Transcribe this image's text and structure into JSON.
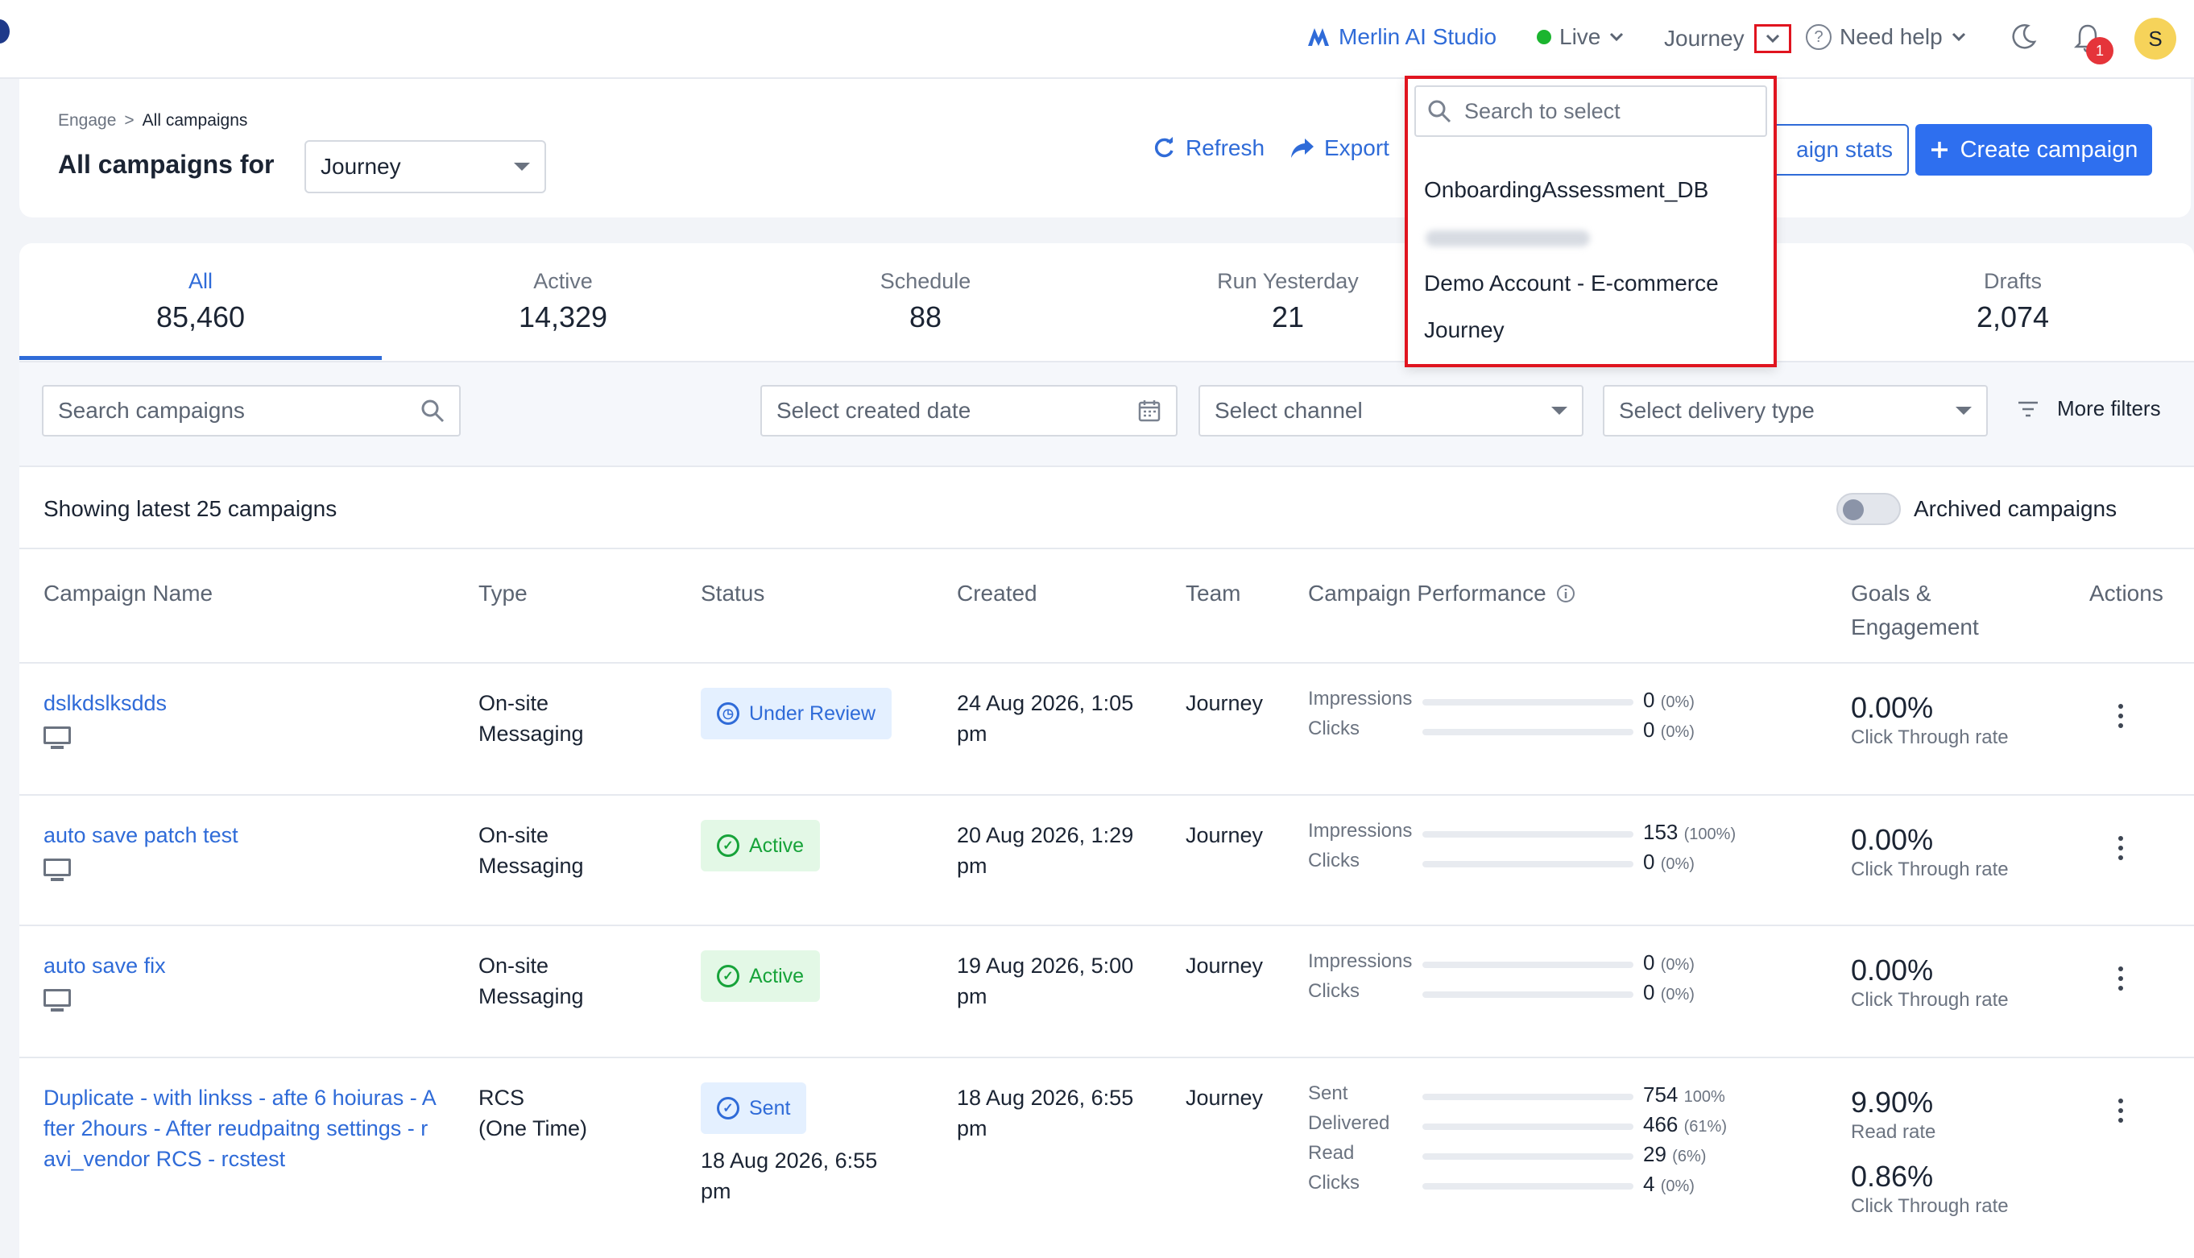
{
  "topbar": {
    "merlin_label": "Merlin AI Studio",
    "live_label": "Live",
    "journey_label": "Journey",
    "help_label": "Need help",
    "notification_count": "1",
    "avatar_initial": "S",
    "live_color": "#1bb52f",
    "accent_color": "#2f6bd8"
  },
  "header": {
    "breadcrumb": [
      "Engage",
      ">",
      "All campaigns"
    ],
    "title": "All campaigns for",
    "account_select_value": "Journey",
    "refresh_label": "Refresh",
    "export_label": "Export",
    "stats_label": "aign stats",
    "create_label": "Create campaign"
  },
  "dropdown": {
    "search_placeholder": "Search to select",
    "items": [
      "OnboardingAssessment_DB",
      "Demo Account - E-commerce",
      "Journey"
    ]
  },
  "tabs": [
    {
      "label": "All",
      "count": "85,460"
    },
    {
      "label": "Active",
      "count": "14,329"
    },
    {
      "label": "Schedule",
      "count": "88"
    },
    {
      "label": "Run Yesterday",
      "count": "21"
    },
    {
      "label": "",
      "count": ""
    },
    {
      "label": "Drafts",
      "count": "2,074"
    }
  ],
  "filters": {
    "search_placeholder": "Search campaigns",
    "date_placeholder": "Select created date",
    "channel_placeholder": "Select channel",
    "delivery_placeholder": "Select delivery type",
    "more_filters": "More filters"
  },
  "list": {
    "showing": "Showing latest 25 campaigns",
    "archived_label": "Archived campaigns"
  },
  "columns": {
    "name": "Campaign Name",
    "type": "Type",
    "status": "Status",
    "created": "Created",
    "team": "Team",
    "performance": "Campaign Performance",
    "goals": "Goals &",
    "goals2": "Engagement",
    "actions": "Actions"
  },
  "rows": [
    {
      "name": "dslkdslksdds",
      "type1": "On-site",
      "type2": "Messaging",
      "status": "Under Review",
      "created1": "24 Aug 2026, 1:05",
      "created2": "pm",
      "team": "Journey",
      "perf": [
        {
          "label": "Impressions",
          "fraction": 0,
          "value": "0",
          "pct": "(0%)"
        },
        {
          "label": "Clicks",
          "fraction": 0,
          "value": "0",
          "pct": "(0%)"
        }
      ],
      "goals": [
        {
          "value": "0.00%",
          "label": "Click Through rate"
        }
      ]
    },
    {
      "name": "auto save patch test",
      "type1": "On-site",
      "type2": "Messaging",
      "status": "Active",
      "created1": "20 Aug 2026, 1:29",
      "created2": "pm",
      "team": "Journey",
      "perf": [
        {
          "label": "Impressions",
          "fraction": 1,
          "value": "153",
          "pct": "(100%)"
        },
        {
          "label": "Clicks",
          "fraction": 0,
          "value": "0",
          "pct": "(0%)"
        }
      ],
      "goals": [
        {
          "value": "0.00%",
          "label": "Click Through rate"
        }
      ]
    },
    {
      "name": "auto save fix",
      "type1": "On-site",
      "type2": "Messaging",
      "status": "Active",
      "created1": "19 Aug 2026, 5:00",
      "created2": "pm",
      "team": "Journey",
      "perf": [
        {
          "label": "Impressions",
          "fraction": 0,
          "value": "0",
          "pct": "(0%)"
        },
        {
          "label": "Clicks",
          "fraction": 0,
          "value": "0",
          "pct": "(0%)"
        }
      ],
      "goals": [
        {
          "value": "0.00%",
          "label": "Click Through rate"
        }
      ]
    },
    {
      "name1": "Duplicate - with linkss - afte 6 hoiuras - A",
      "name2": "fter 2hours - After reudpaitng settings - r",
      "name3": "avi_vendor RCS - rcstest",
      "type1": "RCS",
      "type2": "(One Time)",
      "status": "Sent",
      "sent_date1": "18 Aug 2026, 6:55",
      "sent_date2": "pm",
      "created1": "18 Aug 2026, 6:55",
      "created2": "pm",
      "team": "Journey",
      "perf": [
        {
          "label": "Sent",
          "fraction": 1,
          "value": "754",
          "pct": "100%"
        },
        {
          "label": "Delivered",
          "fraction": 0.61,
          "value": "466",
          "pct": "(61%)"
        },
        {
          "label": "Read",
          "fraction": 0.06,
          "value": "29",
          "pct": "(6%)"
        },
        {
          "label": "Clicks",
          "fraction": 0,
          "value": "4",
          "pct": "(0%)"
        }
      ],
      "goals": [
        {
          "value": "9.90%",
          "label": "Read rate"
        },
        {
          "value": "0.86%",
          "label": "Click Through rate"
        }
      ]
    }
  ]
}
